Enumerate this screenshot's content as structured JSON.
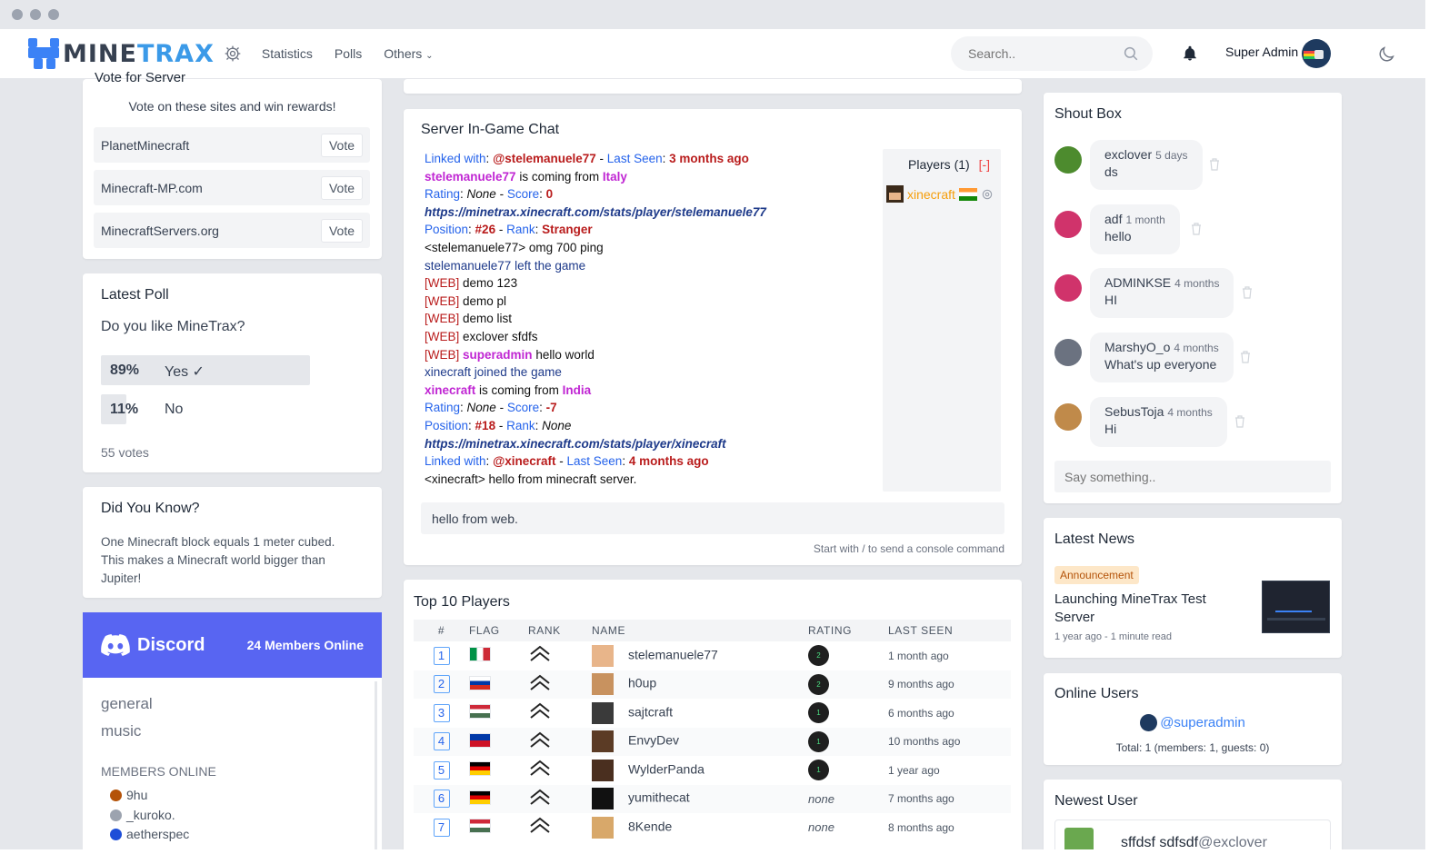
{
  "nav": {
    "logo_a": "MINE",
    "logo_b": "TRAX",
    "links": [
      "Statistics",
      "Polls",
      "Others"
    ],
    "search_placeholder": "Search..",
    "user_name": "Super Admin"
  },
  "vote": {
    "title": "Vote for Server",
    "subtitle": "Vote on these sites and win rewards!",
    "sites": [
      {
        "name": "PlanetMinecraft",
        "button": "Vote"
      },
      {
        "name": "Minecraft-MP.com",
        "button": "Vote"
      },
      {
        "name": "MinecraftServers.org",
        "button": "Vote"
      }
    ]
  },
  "poll": {
    "title": "Latest Poll",
    "question": "Do you like MineTrax?",
    "options": [
      {
        "pct": "89%",
        "label": "Yes ✓",
        "fraction": 0.89
      },
      {
        "pct": "11%",
        "label": "No",
        "fraction": 0.11
      }
    ],
    "votes": "55 votes"
  },
  "dyk": {
    "title": "Did You Know?",
    "text": "One Minecraft block equals 1 meter cubed. This makes a Minecraft world bigger than Jupiter!"
  },
  "discord": {
    "brand": "Discord",
    "online": "24 Members Online",
    "channels": [
      "general",
      "music"
    ],
    "members_header": "MEMBERS ONLINE",
    "members": [
      "9hu",
      "_kuroko.",
      "aetherspec"
    ]
  },
  "chat": {
    "title": "Server In-Game Chat",
    "input_value": "hello from web.",
    "hint": "Start with / to send a console command",
    "players_header": "Players (1)",
    "players_toggle": "[-]",
    "player": "xinecraft",
    "lines": {
      "l1a": "Linked with",
      "l1b": "@stelemanuele77",
      "l1c": "Last Seen",
      "l1d": "3 months ago",
      "l2a": "stelemanuele77",
      "l2b": "is coming from",
      "l2c": "Italy",
      "l3a": "Rating",
      "l3b": "None",
      "l3c": "Score",
      "l3d": "0",
      "l4": "https://minetrax.xinecraft.com/stats/player/stelemanuele77",
      "l5a": "Position",
      "l5b": "#26",
      "l5c": "Rank",
      "l5d": "Stranger",
      "l6": "<stelemanuele77> omg 700 ping",
      "l7": "stelemanuele77 left the game",
      "web": "[WEB]",
      "l8": "demo 123",
      "l9": "demo pl",
      "l10": "demo list",
      "l11": "exclover sfdfs",
      "l12a": "superadmin",
      "l12b": "hello world",
      "l13": "xinecraft joined the game",
      "l14a": "xinecraft",
      "l14b": "is coming from",
      "l14c": "India",
      "l15a": "Rating",
      "l15b": "None",
      "l15c": "Score",
      "l15d": "-7",
      "l16a": "Position",
      "l16b": "#18",
      "l16c": "Rank",
      "l16d": "None",
      "l17": "https://minetrax.xinecraft.com/stats/player/xinecraft",
      "l18a": "Linked with",
      "l18b": "@xinecraft",
      "l18c": "Last Seen",
      "l18d": "4 months ago",
      "l19": "<xinecraft> hello from minecraft server."
    }
  },
  "top": {
    "title": "Top 10 Players",
    "headers": [
      "#",
      "FLAG",
      "RANK",
      "NAME",
      "RATING",
      "LAST SEEN"
    ],
    "rows": [
      {
        "pos": "1",
        "flag": "it",
        "name": "stelemanuele77",
        "rating": "2",
        "seen": "1 month ago"
      },
      {
        "pos": "2",
        "flag": "ru",
        "name": "h0up",
        "rating": "2",
        "seen": "9 months ago"
      },
      {
        "pos": "3",
        "flag": "hu",
        "name": "sajtcraft",
        "rating": "1",
        "seen": "6 months ago"
      },
      {
        "pos": "4",
        "flag": "ph",
        "name": "EnvyDev",
        "rating": "1",
        "seen": "10 months ago"
      },
      {
        "pos": "5",
        "flag": "de",
        "name": "WylderPanda",
        "rating": "1",
        "seen": "1 year ago"
      },
      {
        "pos": "6",
        "flag": "de",
        "name": "yumithecat",
        "rating": "none",
        "seen": "7 months ago"
      },
      {
        "pos": "7",
        "flag": "hu",
        "name": "8Kende",
        "rating": "none",
        "seen": "8 months ago"
      }
    ]
  },
  "shout": {
    "title": "Shout Box",
    "placeholder": "Say something..",
    "items": [
      {
        "user": "exclover",
        "time": "5 days",
        "msg": "ds",
        "color": "#4d8b2e"
      },
      {
        "user": "adf",
        "time": "1 month",
        "msg": "hello",
        "color": "#d0336b"
      },
      {
        "user": "ADMINKSE",
        "time": "4 months",
        "msg": "HI",
        "color": "#d0336b"
      },
      {
        "user": "MarshyO_o",
        "time": "4 months",
        "msg": "What's up everyone",
        "color": "#6b7280"
      },
      {
        "user": "SebusToja",
        "time": "4 months",
        "msg": "Hi",
        "color": "#c08a4a"
      }
    ]
  },
  "news": {
    "title": "Latest News",
    "badge": "Announcement",
    "headline": "Launching MineTrax Test Server",
    "meta": "1 year ago - 1 minute read"
  },
  "online": {
    "title": "Online Users",
    "user": "@superadmin",
    "total": "Total: 1 (members: 1, guests: 0)"
  },
  "newest": {
    "title": "Newest User",
    "name": "sffdsf sdfsdf",
    "handle": "@exclover"
  }
}
